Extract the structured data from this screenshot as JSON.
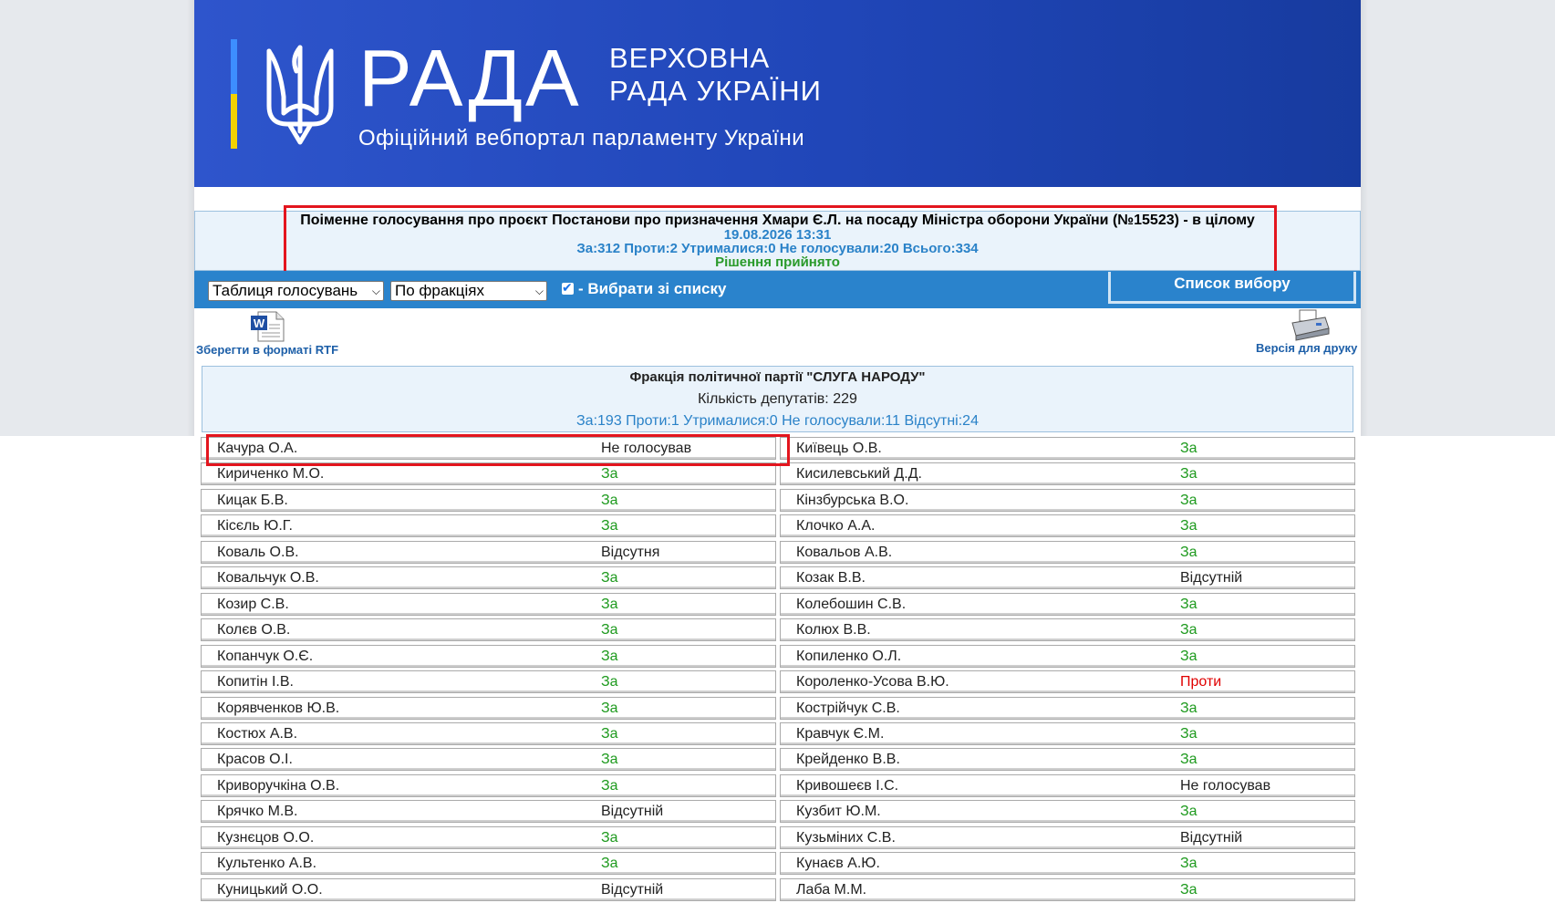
{
  "header": {
    "logo_main": "РАДА",
    "logo_line1": "ВЕРХОВНА",
    "logo_line2": "РАДА УКРАЇНИ",
    "subtitle": "Офіційний вебпортал парламенту України"
  },
  "vote": {
    "title": "Поіменне голосування про проєкт Постанови про призначення Хмари Є.Л. на посаду Міністра оборони України (№15523) - в цілому",
    "datetime": "19.08.2026 13:31",
    "counts": "За:312 Проти:2 Утрималися:0 Не голосували:20 Всього:334",
    "result": "Рішення прийнято"
  },
  "toolbar": {
    "view_select": "Таблиця голосувань",
    "group_select": "По фракціях",
    "checkbox_label": "- Вибрати зі списку",
    "list_button": "Список вибору"
  },
  "actions": {
    "save_rtf": "Зберегти в форматі RTF",
    "print_version": "Версія для друку"
  },
  "faction": {
    "title": "Фракція політичної партії \"СЛУГА НАРОДУ\"",
    "deputies_count": "Кількість депутатів: 229",
    "stats": "За:193 Проти:1 Утрималися:0 Не голосували:11 Відсутні:24"
  },
  "colors": {
    "banner": "#2046b8",
    "toolbar": "#2a83cc",
    "vote_for": "#1e9a1e",
    "vote_against": "#e00000",
    "highlight": "#e3151e"
  },
  "left_column": [
    {
      "name": "Качура О.А.",
      "vote": "Не голосував",
      "type": "other"
    },
    {
      "name": "Кириченко М.О.",
      "vote": "За",
      "type": "for"
    },
    {
      "name": "Кицак Б.В.",
      "vote": "За",
      "type": "for"
    },
    {
      "name": "Кісєль Ю.Г.",
      "vote": "За",
      "type": "for"
    },
    {
      "name": "Коваль О.В.",
      "vote": "Відсутня",
      "type": "other"
    },
    {
      "name": "Ковальчук О.В.",
      "vote": "За",
      "type": "for"
    },
    {
      "name": "Козир С.В.",
      "vote": "За",
      "type": "for"
    },
    {
      "name": "Колєв О.В.",
      "vote": "За",
      "type": "for"
    },
    {
      "name": "Копанчук О.Є.",
      "vote": "За",
      "type": "for"
    },
    {
      "name": "Копитін І.В.",
      "vote": "За",
      "type": "for"
    },
    {
      "name": "Корявченков Ю.В.",
      "vote": "За",
      "type": "for"
    },
    {
      "name": "Костюх А.В.",
      "vote": "За",
      "type": "for"
    },
    {
      "name": "Красов О.І.",
      "vote": "За",
      "type": "for"
    },
    {
      "name": "Криворучкіна О.В.",
      "vote": "За",
      "type": "for"
    },
    {
      "name": "Крячко М.В.",
      "vote": "Відсутній",
      "type": "other"
    },
    {
      "name": "Кузнєцов О.О.",
      "vote": "За",
      "type": "for"
    },
    {
      "name": "Культенко А.В.",
      "vote": "За",
      "type": "for"
    },
    {
      "name": "Куницький О.О.",
      "vote": "Відсутній",
      "type": "other"
    }
  ],
  "right_column": [
    {
      "name": "Київець О.В.",
      "vote": "За",
      "type": "for"
    },
    {
      "name": "Кисилевський Д.Д.",
      "vote": "За",
      "type": "for"
    },
    {
      "name": "Кінзбурська В.О.",
      "vote": "За",
      "type": "for"
    },
    {
      "name": "Клочко А.А.",
      "vote": "За",
      "type": "for"
    },
    {
      "name": "Ковальов А.В.",
      "vote": "За",
      "type": "for"
    },
    {
      "name": "Козак В.В.",
      "vote": "Відсутній",
      "type": "other"
    },
    {
      "name": "Колебошин С.В.",
      "vote": "За",
      "type": "for"
    },
    {
      "name": "Колюх В.В.",
      "vote": "За",
      "type": "for"
    },
    {
      "name": "Копиленко О.Л.",
      "vote": "За",
      "type": "for"
    },
    {
      "name": "Короленко-Усова В.Ю.",
      "vote": "Проти",
      "type": "against"
    },
    {
      "name": "Кострійчук С.В.",
      "vote": "За",
      "type": "for"
    },
    {
      "name": "Кравчук Є.М.",
      "vote": "За",
      "type": "for"
    },
    {
      "name": "Крейденко В.В.",
      "vote": "За",
      "type": "for"
    },
    {
      "name": "Кривошеєв І.С.",
      "vote": "Не голосував",
      "type": "other"
    },
    {
      "name": "Кузбит Ю.М.",
      "vote": "За",
      "type": "for"
    },
    {
      "name": "Кузьміних С.В.",
      "vote": "Відсутній",
      "type": "other"
    },
    {
      "name": "Кунаєв А.Ю.",
      "vote": "За",
      "type": "for"
    },
    {
      "name": "Лаба М.М.",
      "vote": "За",
      "type": "for"
    }
  ]
}
